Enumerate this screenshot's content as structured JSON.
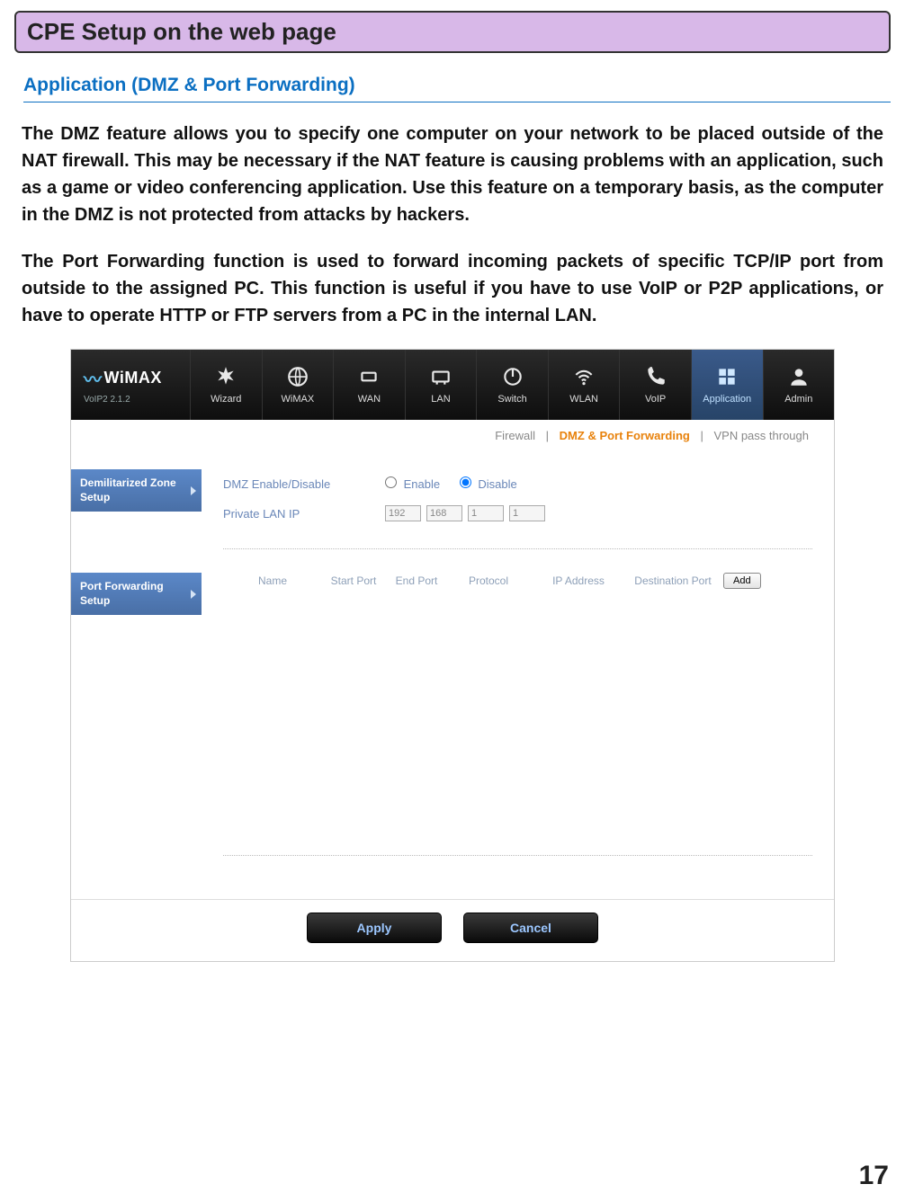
{
  "banner_title": "CPE Setup on the web page",
  "section_heading": "Application (DMZ & Port Forwarding)",
  "paragraph1": "The DMZ feature allows you to specify one computer on your network to be placed outside of the NAT firewall. This may be necessary if the NAT feature is causing problems with an application, such as a game or video conferencing application. Use this feature on a temporary basis, as the computer in the DMZ is not protected from attacks by hackers.",
  "paragraph2": "The Port Forwarding function is used to forward incoming packets of specific TCP/IP port from outside to the assigned PC. This function is useful if you have to use VoIP or P2P applications, or have to operate HTTP or FTP servers from a PC in the internal LAN.",
  "page_number": "17",
  "router": {
    "logo": "WiMAX",
    "version": "VoIP2 2.1.2",
    "nav": [
      "Wizard",
      "WiMAX",
      "WAN",
      "LAN",
      "Switch",
      "WLAN",
      "VoIP",
      "Application",
      "Admin"
    ],
    "nav_icons": [
      "asterisk-icon",
      "globe-icon",
      "wan-icon",
      "lan-icon",
      "power-icon",
      "wifi-icon",
      "phone-icon",
      "application-icon",
      "admin-icon"
    ],
    "subtabs": {
      "firewall": "Firewall",
      "active": "DMZ & Port Forwarding",
      "vpn": "VPN pass through",
      "sep": "|"
    },
    "sidebar": {
      "dmz": "Demilitarized Zone Setup",
      "pf": "Port Forwarding Setup"
    },
    "dmz": {
      "label_enable": "DMZ Enable/Disable",
      "enable": "Enable",
      "disable": "Disable",
      "label_ip": "Private LAN IP",
      "ip": [
        "192",
        "168",
        "1",
        "1"
      ]
    },
    "pf": {
      "cols": {
        "name": "Name",
        "start": "Start Port",
        "end": "End Port",
        "proto": "Protocol",
        "ip": "IP Address",
        "dest": "Destination Port"
      },
      "add": "Add"
    },
    "buttons": {
      "apply": "Apply",
      "cancel": "Cancel"
    }
  }
}
